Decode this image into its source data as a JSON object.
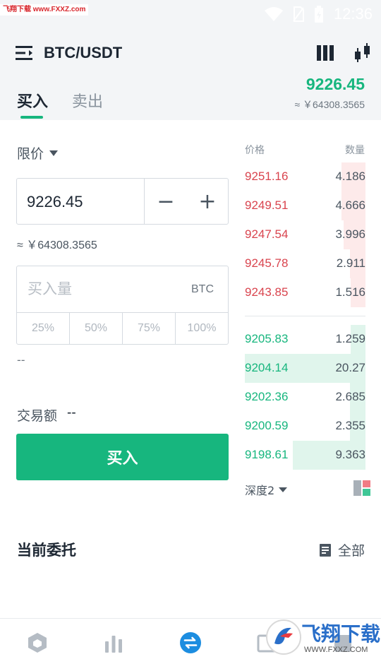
{
  "status_bar": {
    "watermark": "飞翔下载 www.FXXZ.com",
    "time": "12:36"
  },
  "header": {
    "pair": "BTC/USDT",
    "menu_icon": "menu-icon",
    "tabs": [
      {
        "label": "买入",
        "active": true
      },
      {
        "label": "卖出",
        "active": false
      }
    ],
    "last_price": "9226.45",
    "last_price_cny": "≈ ￥64308.3565",
    "accent_color": "#17b67e",
    "sell_color": "#d9444e"
  },
  "order_form": {
    "order_type": "限价",
    "price": "9226.45",
    "minus": "−",
    "plus": "+",
    "price_cny": "≈ ￥64308.3565",
    "amount_placeholder": "买入量",
    "amount_unit": "BTC",
    "percentages": [
      "25%",
      "50%",
      "75%",
      "100%"
    ],
    "available": "--",
    "trade_amount_label": "交易额",
    "trade_amount_value": "--",
    "submit_label": "买入"
  },
  "order_book": {
    "price_header": "价格",
    "qty_header": "数量",
    "asks": [
      {
        "price": "9251.16",
        "qty": "4.186",
        "depth": 0.2
      },
      {
        "price": "9249.51",
        "qty": "4.666",
        "depth": 0.2
      },
      {
        "price": "9247.54",
        "qty": "3.996",
        "depth": 0.18
      },
      {
        "price": "9245.78",
        "qty": "2.911",
        "depth": 0.13
      },
      {
        "price": "9243.85",
        "qty": "1.516",
        "depth": 0.12
      }
    ],
    "bids": [
      {
        "price": "9205.83",
        "qty": "1.259",
        "depth": 0.12
      },
      {
        "price": "9204.14",
        "qty": "20.27",
        "depth": 1.0
      },
      {
        "price": "9202.36",
        "qty": "2.685",
        "depth": 0.13
      },
      {
        "price": "9200.59",
        "qty": "2.355",
        "depth": 0.13
      },
      {
        "price": "9198.61",
        "qty": "9.363",
        "depth": 0.6
      }
    ],
    "depth_label": "深度2"
  },
  "orders": {
    "title": "当前委托",
    "all_label": "全部"
  },
  "bottom_nav": [
    "home-icon",
    "market-icon",
    "trade-icon",
    "assets-icon",
    "profile-icon"
  ],
  "bottom_watermark": {
    "brand": "飞翔下载",
    "url": "WWW.FXXZ.COM"
  }
}
